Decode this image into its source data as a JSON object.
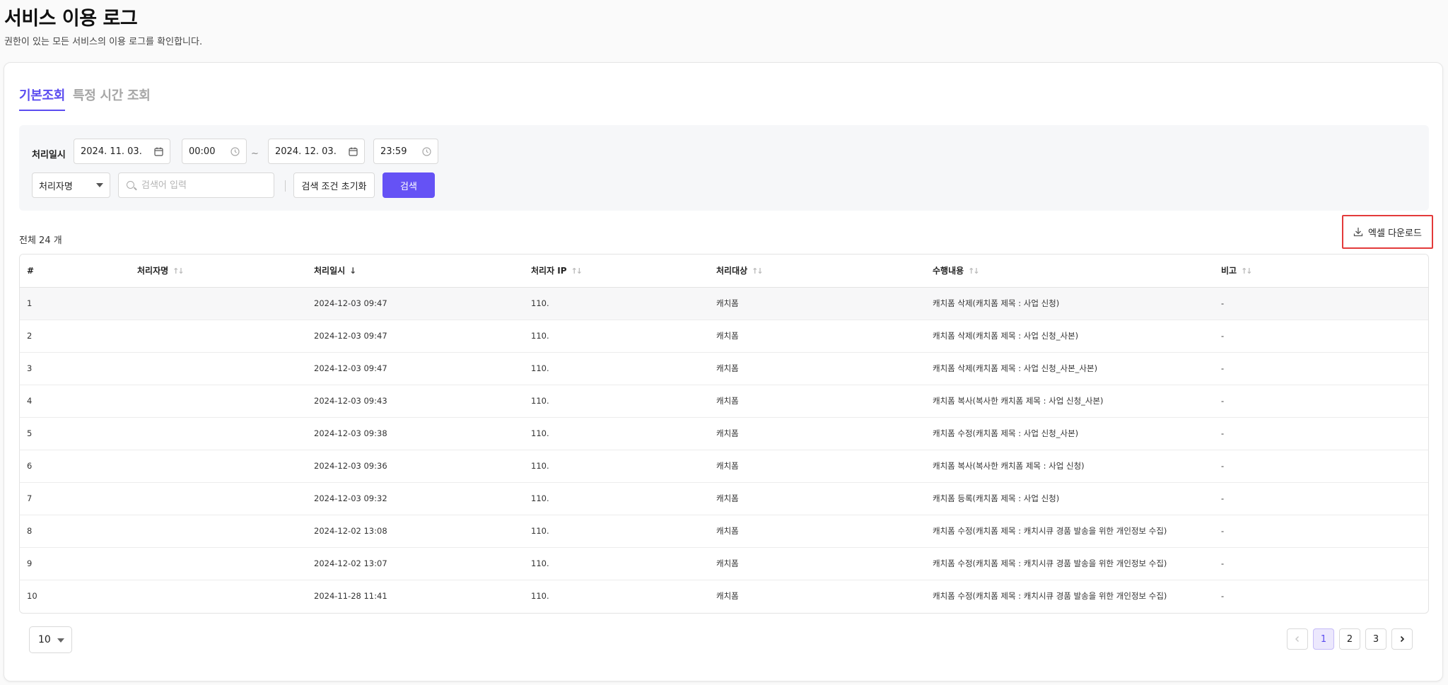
{
  "header": {
    "title": "서비스 이용 로그",
    "subtitle": "권한이 있는 모든 서비스의 이용 로그를 확인합니다."
  },
  "tabs": [
    {
      "label": "기본조회",
      "active": true
    },
    {
      "label": "특정 시간 조회",
      "active": false
    }
  ],
  "filters": {
    "date_label": "처리일시",
    "start_date": "2024. 11. 03.",
    "start_time": "00:00",
    "separator": "~",
    "end_date": "2024. 12. 03.",
    "end_time": "23:59",
    "search_field_selected": "처리자명",
    "search_placeholder": "검색어 입력",
    "reset_label": "검색 조건 초기화",
    "search_label": "검색"
  },
  "summary": {
    "total_text": "전체 24 개"
  },
  "toolbar": {
    "excel_label": "엑셀 다운로드"
  },
  "table": {
    "columns": [
      "#",
      "처리자명",
      "처리일시",
      "처리자 IP",
      "처리대상",
      "수행내용",
      "비고"
    ],
    "rows": [
      {
        "no": "1",
        "user": "",
        "datetime": "2024-12-03 09:47",
        "ip": "110.",
        "target": "캐치폼",
        "action": "캐치폼 삭제(캐치폼 제목 : 사업 신청)",
        "note": "-"
      },
      {
        "no": "2",
        "user": "",
        "datetime": "2024-12-03 09:47",
        "ip": "110.",
        "target": "캐치폼",
        "action": "캐치폼 삭제(캐치폼 제목 : 사업 신청_사본)",
        "note": "-"
      },
      {
        "no": "3",
        "user": "",
        "datetime": "2024-12-03 09:47",
        "ip": "110.",
        "target": "캐치폼",
        "action": "캐치폼 삭제(캐치폼 제목 : 사업 신청_사본_사본)",
        "note": "-"
      },
      {
        "no": "4",
        "user": "",
        "datetime": "2024-12-03 09:43",
        "ip": "110.",
        "target": "캐치폼",
        "action": "캐치폼 복사(복사한 캐치폼 제목 : 사업 신청_사본)",
        "note": "-"
      },
      {
        "no": "5",
        "user": "",
        "datetime": "2024-12-03 09:38",
        "ip": "110.",
        "target": "캐치폼",
        "action": "캐치폼 수정(캐치폼 제목 : 사업 신청_사본)",
        "note": "-"
      },
      {
        "no": "6",
        "user": "",
        "datetime": "2024-12-03 09:36",
        "ip": "110.",
        "target": "캐치폼",
        "action": "캐치폼 복사(복사한 캐치폼 제목 : 사업 신청)",
        "note": "-"
      },
      {
        "no": "7",
        "user": "",
        "datetime": "2024-12-03 09:32",
        "ip": "110.",
        "target": "캐치폼",
        "action": "캐치폼 등록(캐치폼 제목 : 사업 신청)",
        "note": "-"
      },
      {
        "no": "8",
        "user": "",
        "datetime": "2024-12-02 13:08",
        "ip": "110.",
        "target": "캐치폼",
        "action": "캐치폼 수정(캐치폼 제목 : 캐치시큐 경품 발송을 위한 개인정보 수집)",
        "note": "-"
      },
      {
        "no": "9",
        "user": "",
        "datetime": "2024-12-02 13:07",
        "ip": "110.",
        "target": "캐치폼",
        "action": "캐치폼 수정(캐치폼 제목 : 캐치시큐 경품 발송을 위한 개인정보 수집)",
        "note": "-"
      },
      {
        "no": "10",
        "user": "",
        "datetime": "2024-11-28 11:41",
        "ip": "110.",
        "target": "캐치폼",
        "action": "캐치폼 수정(캐치폼 제목 : 캐치시큐 경품 발송을 위한 개인정보 수집)",
        "note": "-"
      }
    ]
  },
  "pagination": {
    "page_size": "10",
    "pages": [
      "1",
      "2",
      "3"
    ],
    "current": "1",
    "prev_icon": "chevron-left-icon",
    "next_icon": "chevron-right-icon"
  },
  "colors": {
    "accent": "#5b4cf0",
    "primary_button": "#6552f5",
    "highlight_border": "#e33a3a"
  }
}
